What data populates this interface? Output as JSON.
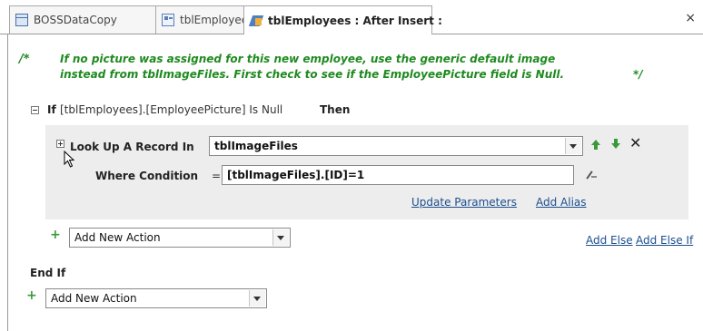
{
  "tabs": [
    {
      "label": "BOSSDataCopy",
      "icon": "table-icon",
      "active": false
    },
    {
      "label": "tblEmployees",
      "icon": "form-icon",
      "active": false
    },
    {
      "label": "tblEmployees : After Insert :",
      "icon": "macro-icon",
      "active": true
    }
  ],
  "close_glyph": "×",
  "comment": {
    "open": "/*",
    "text": "If no picture was assigned for this new employee, use the generic default image instead from tblImageFiles. First check to see if the EmployeePicture field is Null.",
    "close": "*/"
  },
  "if_block": {
    "keyword_if": "If",
    "condition": "[tblEmployees].[EmployeePicture] Is Null",
    "keyword_then": "Then",
    "keyword_end": "End If"
  },
  "action": {
    "label": "Look Up A Record In",
    "value": "tblImageFiles",
    "where_label": "Where Condition",
    "equals": "=",
    "where_value": "[tblImageFiles].[ID]=1",
    "update_parameters": "Update Parameters",
    "add_alias": "Add Alias"
  },
  "inner_new_action": {
    "placeholder": "Add New Action"
  },
  "add_else": "Add Else",
  "add_else_if": "Add Else If",
  "outer_new_action": {
    "placeholder": "Add New Action"
  },
  "colors": {
    "comment": "#1f8a1f",
    "link": "#1c4e8f",
    "block_bg": "#ededed",
    "arrow": "#3a9a3a"
  }
}
